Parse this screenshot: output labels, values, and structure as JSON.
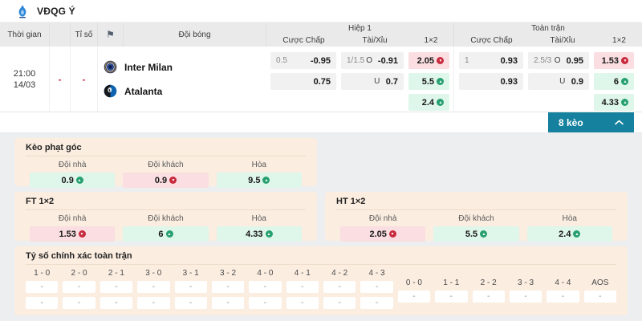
{
  "colors": {
    "accent_teal": "#16819F",
    "up_green": "#27A070",
    "down_red": "#C8293C",
    "tint_green": "#DFF6EA",
    "tint_pink": "#FADEE1",
    "card_peach": "#FBEDE0"
  },
  "league": {
    "name": "VĐQG Ý"
  },
  "table": {
    "headers": {
      "time": "Thời gian",
      "score": "Tỉ số",
      "team": "Đội bóng",
      "group_h1": "Hiệp 1",
      "group_ft": "Toàn trận",
      "handicap": "Cược Chấp",
      "over_under": "Tài/Xỉu",
      "one_x_two": "1×2"
    },
    "match": {
      "time": "21:00",
      "date": "14/03",
      "live_score": "-",
      "score": "-",
      "home_team": "Inter Milan",
      "away_team": "Atalanta",
      "h1": {
        "handicap": [
          {
            "line": "0.5",
            "odds": "-0.95"
          },
          {
            "line": "",
            "odds": "0.75"
          }
        ],
        "over_under": [
          {
            "line": "1/1.5",
            "side": "O",
            "odds": "-0.91"
          },
          {
            "line": "",
            "side": "U",
            "odds": "0.7"
          }
        ],
        "one_x_two": [
          {
            "odds": "2.05",
            "trend": "down"
          },
          {
            "odds": "5.5",
            "trend": "up"
          },
          {
            "odds": "2.4",
            "trend": "up"
          }
        ]
      },
      "ft": {
        "handicap": [
          {
            "line": "1",
            "odds": "0.93"
          },
          {
            "line": "",
            "odds": "0.93"
          }
        ],
        "over_under": [
          {
            "line": "2.5/3",
            "side": "O",
            "odds": "0.95"
          },
          {
            "line": "",
            "side": "U",
            "odds": "0.9"
          }
        ],
        "one_x_two": [
          {
            "odds": "1.53",
            "trend": "down"
          },
          {
            "odds": "6",
            "trend": "up"
          },
          {
            "odds": "4.33",
            "trend": "up"
          }
        ]
      }
    }
  },
  "more_bets": {
    "label": "8 kèo"
  },
  "sections": {
    "cols": {
      "home": "Đội nhà",
      "away": "Đội khách",
      "draw": "Hòa"
    },
    "corner": {
      "title": "Kèo phạt góc",
      "home": {
        "odds": "0.9",
        "trend": "up"
      },
      "away": {
        "odds": "0.9",
        "trend": "down"
      },
      "draw": {
        "odds": "9.5",
        "trend": "up"
      }
    },
    "ft_1x2": {
      "title": "FT 1×2",
      "home": {
        "odds": "1.53",
        "trend": "down"
      },
      "away": {
        "odds": "6",
        "trend": "up"
      },
      "draw": {
        "odds": "4.33",
        "trend": "up"
      }
    },
    "ht_1x2": {
      "title": "HT 1×2",
      "home": {
        "odds": "2.05",
        "trend": "down"
      },
      "away": {
        "odds": "5.5",
        "trend": "up"
      },
      "draw": {
        "odds": "2.4",
        "trend": "up"
      }
    },
    "correct_score": {
      "title": "Tỷ số chính xác toàn trận",
      "placeholder": "-",
      "scores_two_row": [
        "1 - 0",
        "2 - 0",
        "2 - 1",
        "3 - 0",
        "3 - 1",
        "3 - 2",
        "4 - 0",
        "4 - 1",
        "4 - 2",
        "4 - 3"
      ],
      "scores_one_row": [
        "0 - 0",
        "1 - 1",
        "2 - 2",
        "3 - 3",
        "4 - 4",
        "AOS"
      ]
    }
  }
}
